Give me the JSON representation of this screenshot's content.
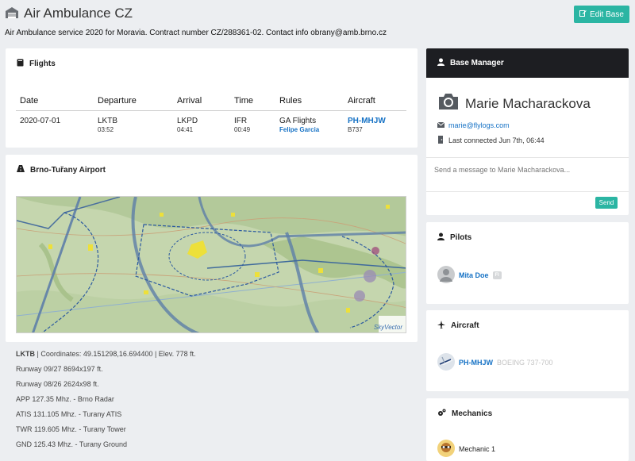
{
  "header": {
    "title": "Air Ambulance CZ",
    "edit_label": "Edit Base",
    "description": "Air Ambulance service 2020 for Moravia. Contract number CZ/288361-02. Contact info obrany@amb.brno.cz"
  },
  "flights": {
    "title": "Flights",
    "columns": [
      "Date",
      "Departure",
      "Arrival",
      "Time",
      "Rules",
      "Aircraft"
    ],
    "rows": [
      {
        "date": "2020-07-01",
        "departure": "LKTB",
        "departure_time": "03:52",
        "arrival": "LKPD",
        "arrival_time": "04:41",
        "time": "IFR",
        "time_duration": "00:49",
        "rules": "GA Flights",
        "pilot": "Felipe Garcia",
        "aircraft": "PH-MHJW",
        "aircraft_type": "B737"
      }
    ]
  },
  "airport": {
    "title": "Brno-Tuřany Airport",
    "map_credit": "SkyVector",
    "code": "LKTB",
    "summary": " | Coordinates: 49.151298,16.694400 | Elev. 778 ft.",
    "lines": [
      "Runway 09/27 8694x197 ft.",
      "Runway 08/26 2624x98 ft.",
      "APP 127.35 Mhz. - Brno Radar",
      "ATIS 131.105 Mhz. - Turany ATIS",
      "TWR 119.605 Mhz. - Turany Tower",
      "GND 125.43 Mhz. - Turany Ground"
    ]
  },
  "manager": {
    "title": "Base Manager",
    "name": "Marie Macharackova",
    "email": "marie@flylogs.com",
    "last_connected": "Last connected Jun 7th, 06:44",
    "message_placeholder": "Send a message to Marie Macharackova...",
    "send_label": "Send"
  },
  "pilots": {
    "title": "Pilots",
    "items": [
      {
        "name": "Mita Doe",
        "badge": "FI"
      }
    ]
  },
  "aircraft": {
    "title": "Aircraft",
    "items": [
      {
        "registration": "PH-MHJW",
        "model": "BOEING 737-700"
      }
    ]
  },
  "mechanics": {
    "title": "Mechanics",
    "items": [
      {
        "name": "Mechanic 1"
      }
    ]
  },
  "colors": {
    "accent": "#2bb5a3",
    "link": "#1672c5",
    "dark_header": "#1d1e22",
    "background": "#eceef1"
  }
}
